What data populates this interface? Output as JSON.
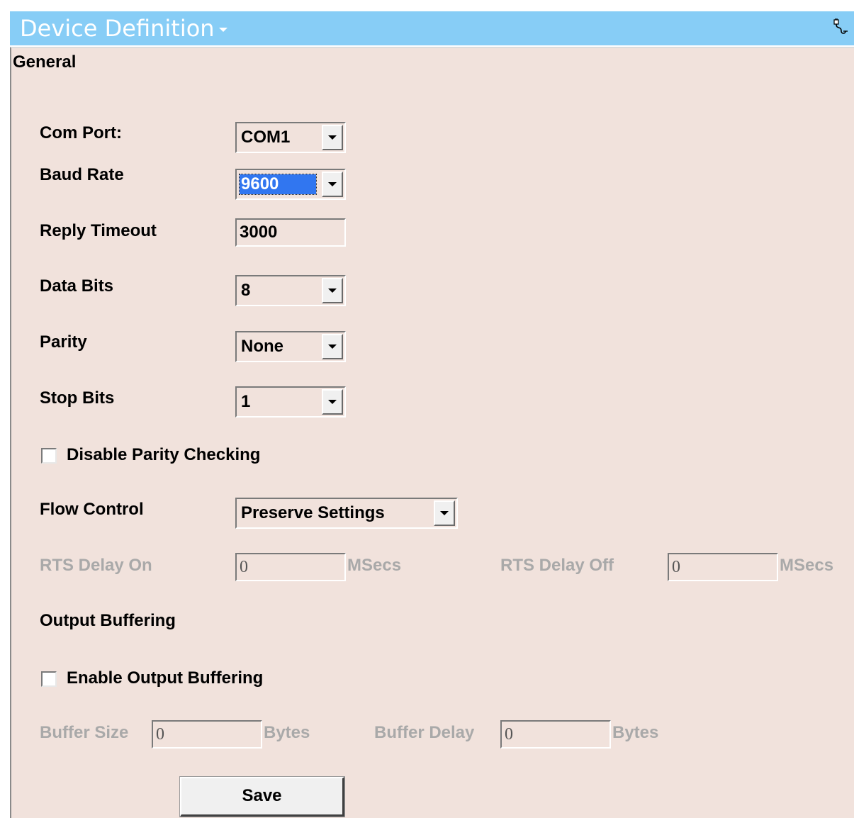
{
  "header": {
    "title": "Device Definition"
  },
  "section": {
    "title": "General"
  },
  "fields": {
    "com_port": {
      "label": "Com Port:",
      "value": "COM1"
    },
    "baud_rate": {
      "label": "Baud Rate",
      "value": "9600"
    },
    "reply_timeout": {
      "label": "Reply Timeout",
      "value": "3000"
    },
    "data_bits": {
      "label": "Data Bits",
      "value": "8"
    },
    "parity": {
      "label": "Parity",
      "value": "None"
    },
    "stop_bits": {
      "label": "Stop Bits",
      "value": "1"
    },
    "disable_parity": {
      "label": "Disable Parity Checking",
      "checked": false
    },
    "flow_control": {
      "label": "Flow Control",
      "value": "Preserve Settings"
    },
    "rts_delay_on": {
      "label": "RTS Delay On",
      "value": "0",
      "unit": "MSecs"
    },
    "rts_delay_off": {
      "label": "RTS Delay Off",
      "value": "0",
      "unit": "MSecs"
    }
  },
  "output_buffering": {
    "title": "Output Buffering",
    "enable": {
      "label": "Enable Output Buffering",
      "checked": false
    },
    "buffer_size": {
      "label": "Buffer Size",
      "value": "0",
      "unit": "Bytes"
    },
    "buffer_delay": {
      "label": "Buffer Delay",
      "value": "0",
      "unit": "Bytes"
    }
  },
  "actions": {
    "save_label": "Save"
  },
  "colors": {
    "header_bg": "#87cdf6",
    "panel_bg": "#f1e2dc",
    "selection": "#3176f0"
  },
  "icons": {
    "header_icon": "plug-icon",
    "dropdown": "chevron-down-icon"
  }
}
